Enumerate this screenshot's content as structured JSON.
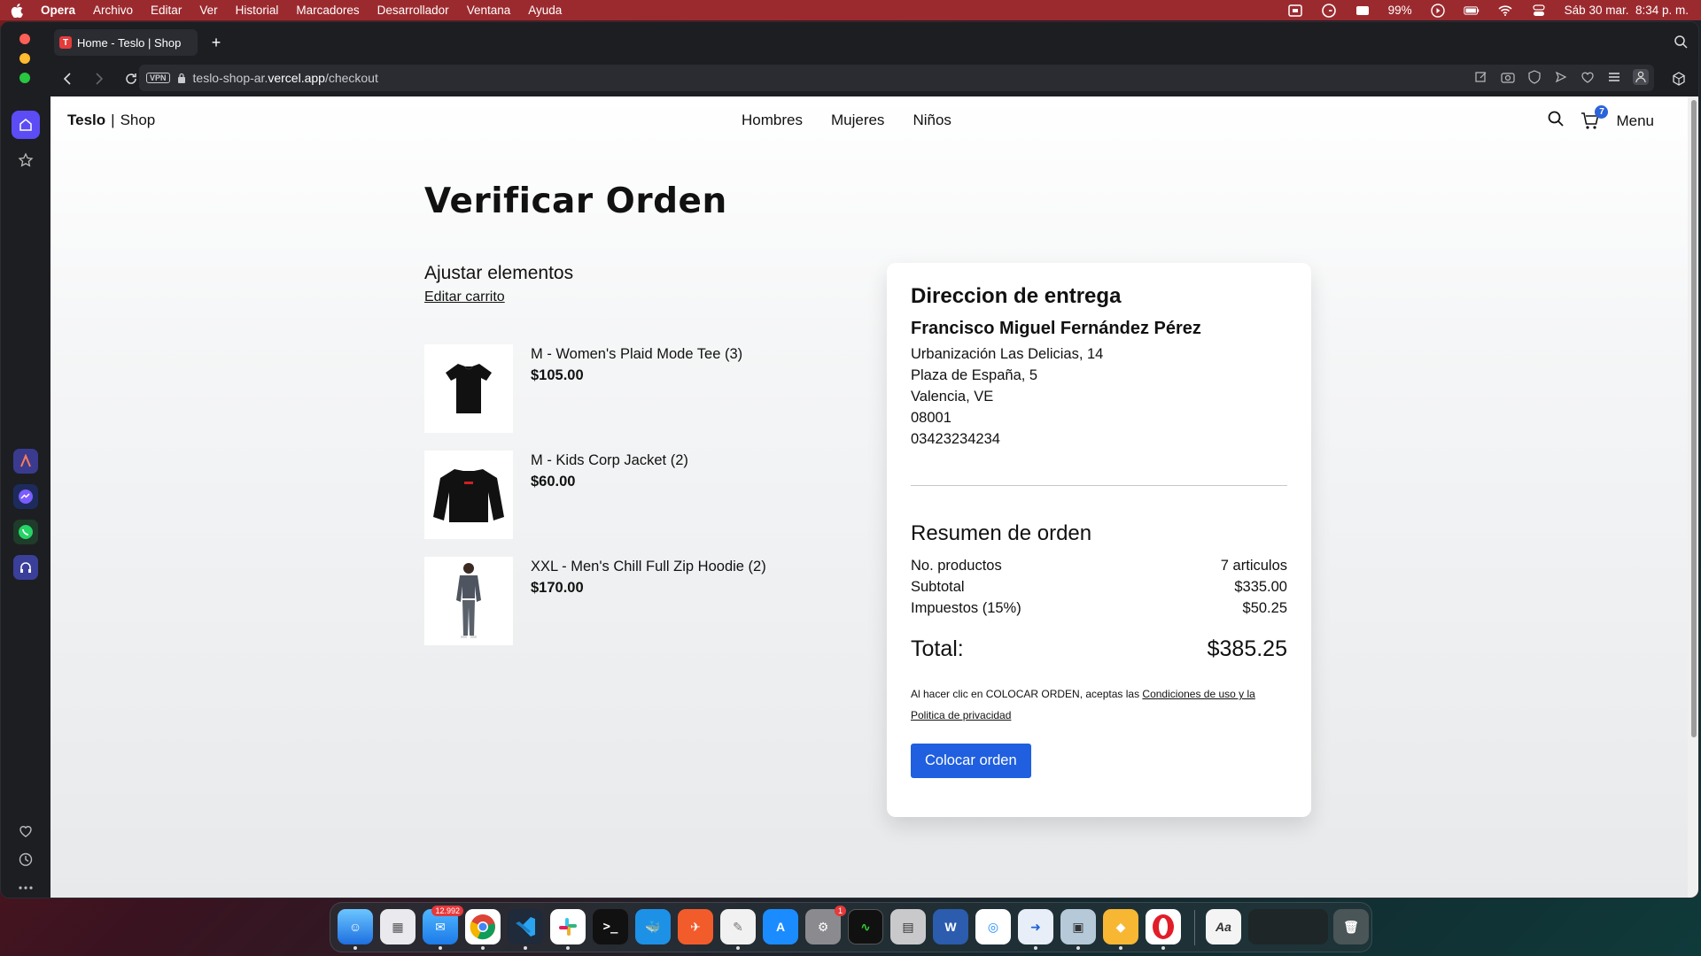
{
  "menubar": {
    "app": "Opera",
    "items": [
      "Archivo",
      "Editar",
      "Ver",
      "Historial",
      "Marcadores",
      "Desarrollador",
      "Ventana",
      "Ayuda"
    ],
    "battery": "99%",
    "datetime": "Sáb 30 mar.  8:34 p. m."
  },
  "browser": {
    "tab_title": "Home - Teslo | Shop",
    "url_host": "teslo-shop-ar.",
    "url_domain": "vercel.app",
    "url_path": "/checkout",
    "vpn_label": "VPN"
  },
  "site": {
    "logo_bold": "Teslo",
    "logo_sep": "|",
    "logo_rest": "Shop",
    "nav": [
      "Hombres",
      "Mujeres",
      "Niños"
    ],
    "cart_count": "7",
    "menu_label": "Menu"
  },
  "checkout": {
    "title": "Verificar Orden",
    "adjust_title": "Ajustar elementos",
    "edit_cart": "Editar carrito",
    "items": [
      {
        "title": "M - Women's Plaid Mode Tee (3)",
        "price": "$105.00",
        "image": "black-tshirt"
      },
      {
        "title": "M - Kids Corp Jacket (2)",
        "price": "$60.00",
        "image": "black-jacket"
      },
      {
        "title": "XXL - Men's Chill Full Zip Hoodie (2)",
        "price": "$170.00",
        "image": "person-grey-hoodie"
      }
    ]
  },
  "delivery": {
    "heading": "Direccion de entrega",
    "name": "Francisco Miguel Fernández Pérez",
    "lines": [
      "Urbanización Las Delicias, 14",
      "Plaza de España, 5",
      "Valencia, VE",
      "08001",
      "03423234234"
    ]
  },
  "summary": {
    "heading": "Resumen de orden",
    "rows": [
      {
        "label": "No. productos",
        "value": "7 articulos"
      },
      {
        "label": "Subtotal",
        "value": "$335.00"
      },
      {
        "label": "Impuestos (15%)",
        "value": "$50.25"
      }
    ],
    "total_label": "Total:",
    "total_value": "$385.25",
    "terms_prefix": "Al hacer clic en COLOCAR ORDEN, aceptas las ",
    "terms_link": "Condiciones de uso y la Politica de privacidad",
    "button": "Colocar orden"
  },
  "dock": {
    "mail_badge": "12.992",
    "settings_badge": "1"
  },
  "colors": {
    "accent": "#1f5fe0",
    "menubar": "#9b2a2f",
    "browser_chrome": "#1d1e22",
    "sidebar_active": "#5b4cf5"
  }
}
